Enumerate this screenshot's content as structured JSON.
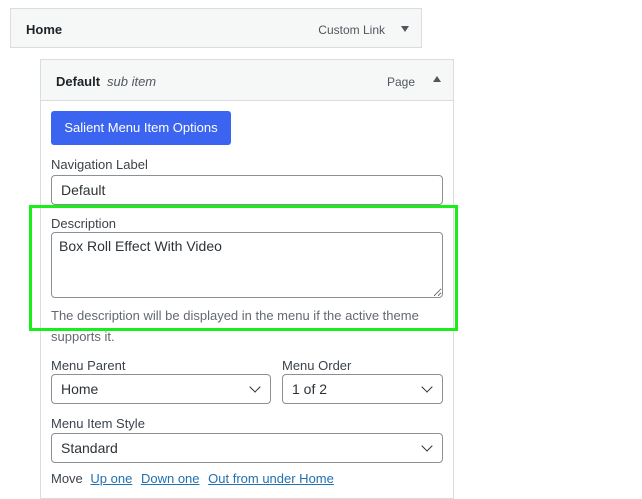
{
  "parent_item": {
    "title": "Home",
    "type": "Custom Link"
  },
  "sub_item": {
    "title": "Default",
    "subtitle": "sub item",
    "type": "Page"
  },
  "salient_button": "Salient Menu Item Options",
  "navigation_label": {
    "label": "Navigation Label",
    "value": "Default"
  },
  "description": {
    "label": "Description",
    "value": "Box Roll Effect With Video",
    "help_line1": "The description will be displayed in the menu if the active theme",
    "help_line2": "supports it."
  },
  "menu_parent": {
    "label": "Menu Parent",
    "selected": "Home"
  },
  "menu_order": {
    "label": "Menu Order",
    "selected": "1 of 2"
  },
  "menu_item_style": {
    "label": "Menu Item Style",
    "selected": "Standard"
  },
  "move": {
    "label": "Move",
    "up_one": "Up one",
    "down_one": "Down one",
    "out_from_under": "Out from under Home"
  },
  "colors": {
    "button_blue": "#3b65f0",
    "highlight_green": "#1aee1a",
    "link_blue": "#2271b1"
  }
}
